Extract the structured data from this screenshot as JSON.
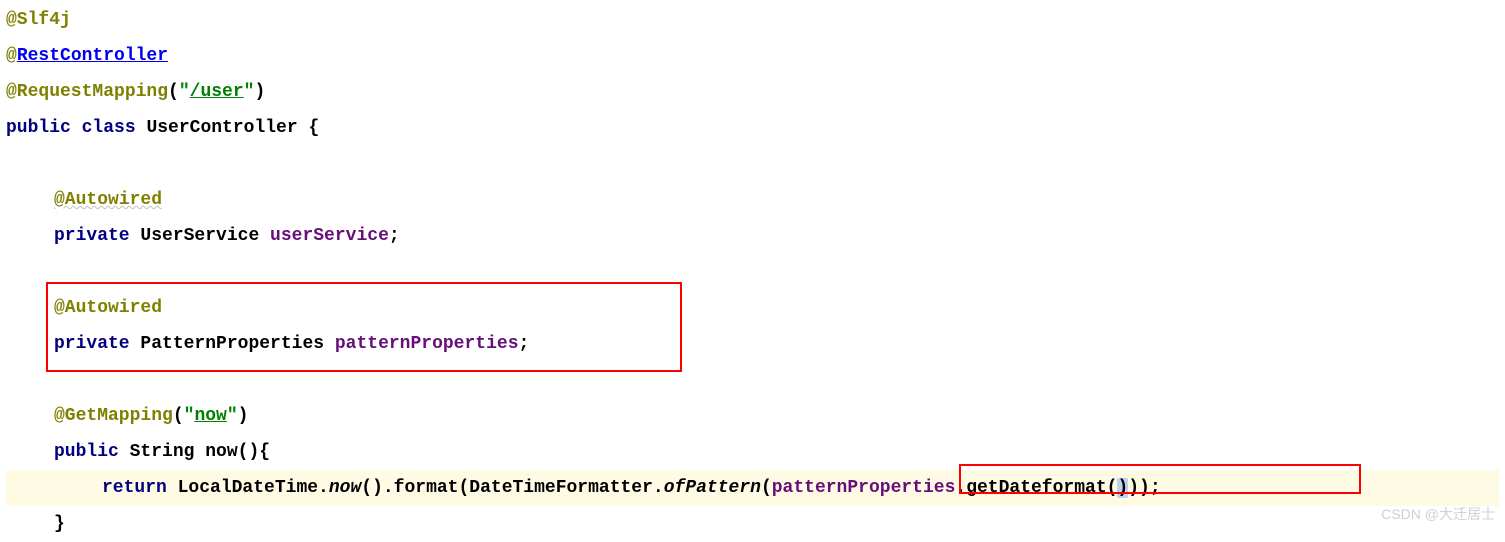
{
  "code": {
    "line1": {
      "annotation": "@Slf4j"
    },
    "line2": {
      "at": "@",
      "annotation": "RestController"
    },
    "line3": {
      "annotation": "@RequestMapping",
      "paren_open": "(",
      "quote": "\"",
      "path": "/user",
      "quote2": "\"",
      "paren_close": ")"
    },
    "line4": {
      "public": "public ",
      "class": "class ",
      "name": "UserController {"
    },
    "line6": {
      "annotation": "@Autowired"
    },
    "line7": {
      "private": "private ",
      "type": "UserService ",
      "field": "userService",
      "semi": ";"
    },
    "line9": {
      "annotation": "@Autowired"
    },
    "line10": {
      "private": "private ",
      "type": "PatternProperties ",
      "field": "patternProperties",
      "semi": ";"
    },
    "line12": {
      "annotation": "@GetMapping",
      "paren_open": "(",
      "quote": "\"",
      "path": "now",
      "quote2": "\"",
      "paren_close": ")"
    },
    "line13": {
      "public": "public ",
      "type": "String ",
      "name": "now(){"
    },
    "line14": {
      "return": "return ",
      "class1": "LocalDateTime.",
      "method1": "now",
      "mid1": "().format(DateTimeFormatter.",
      "method2": "ofPattern",
      "paren1": "(",
      "field": "patternProperties",
      "mid2": ".getDateformat(",
      "closing_paren": ")",
      "tail": "));"
    },
    "line15": {
      "brace": "}"
    }
  },
  "watermark": "CSDN @大迁居士"
}
